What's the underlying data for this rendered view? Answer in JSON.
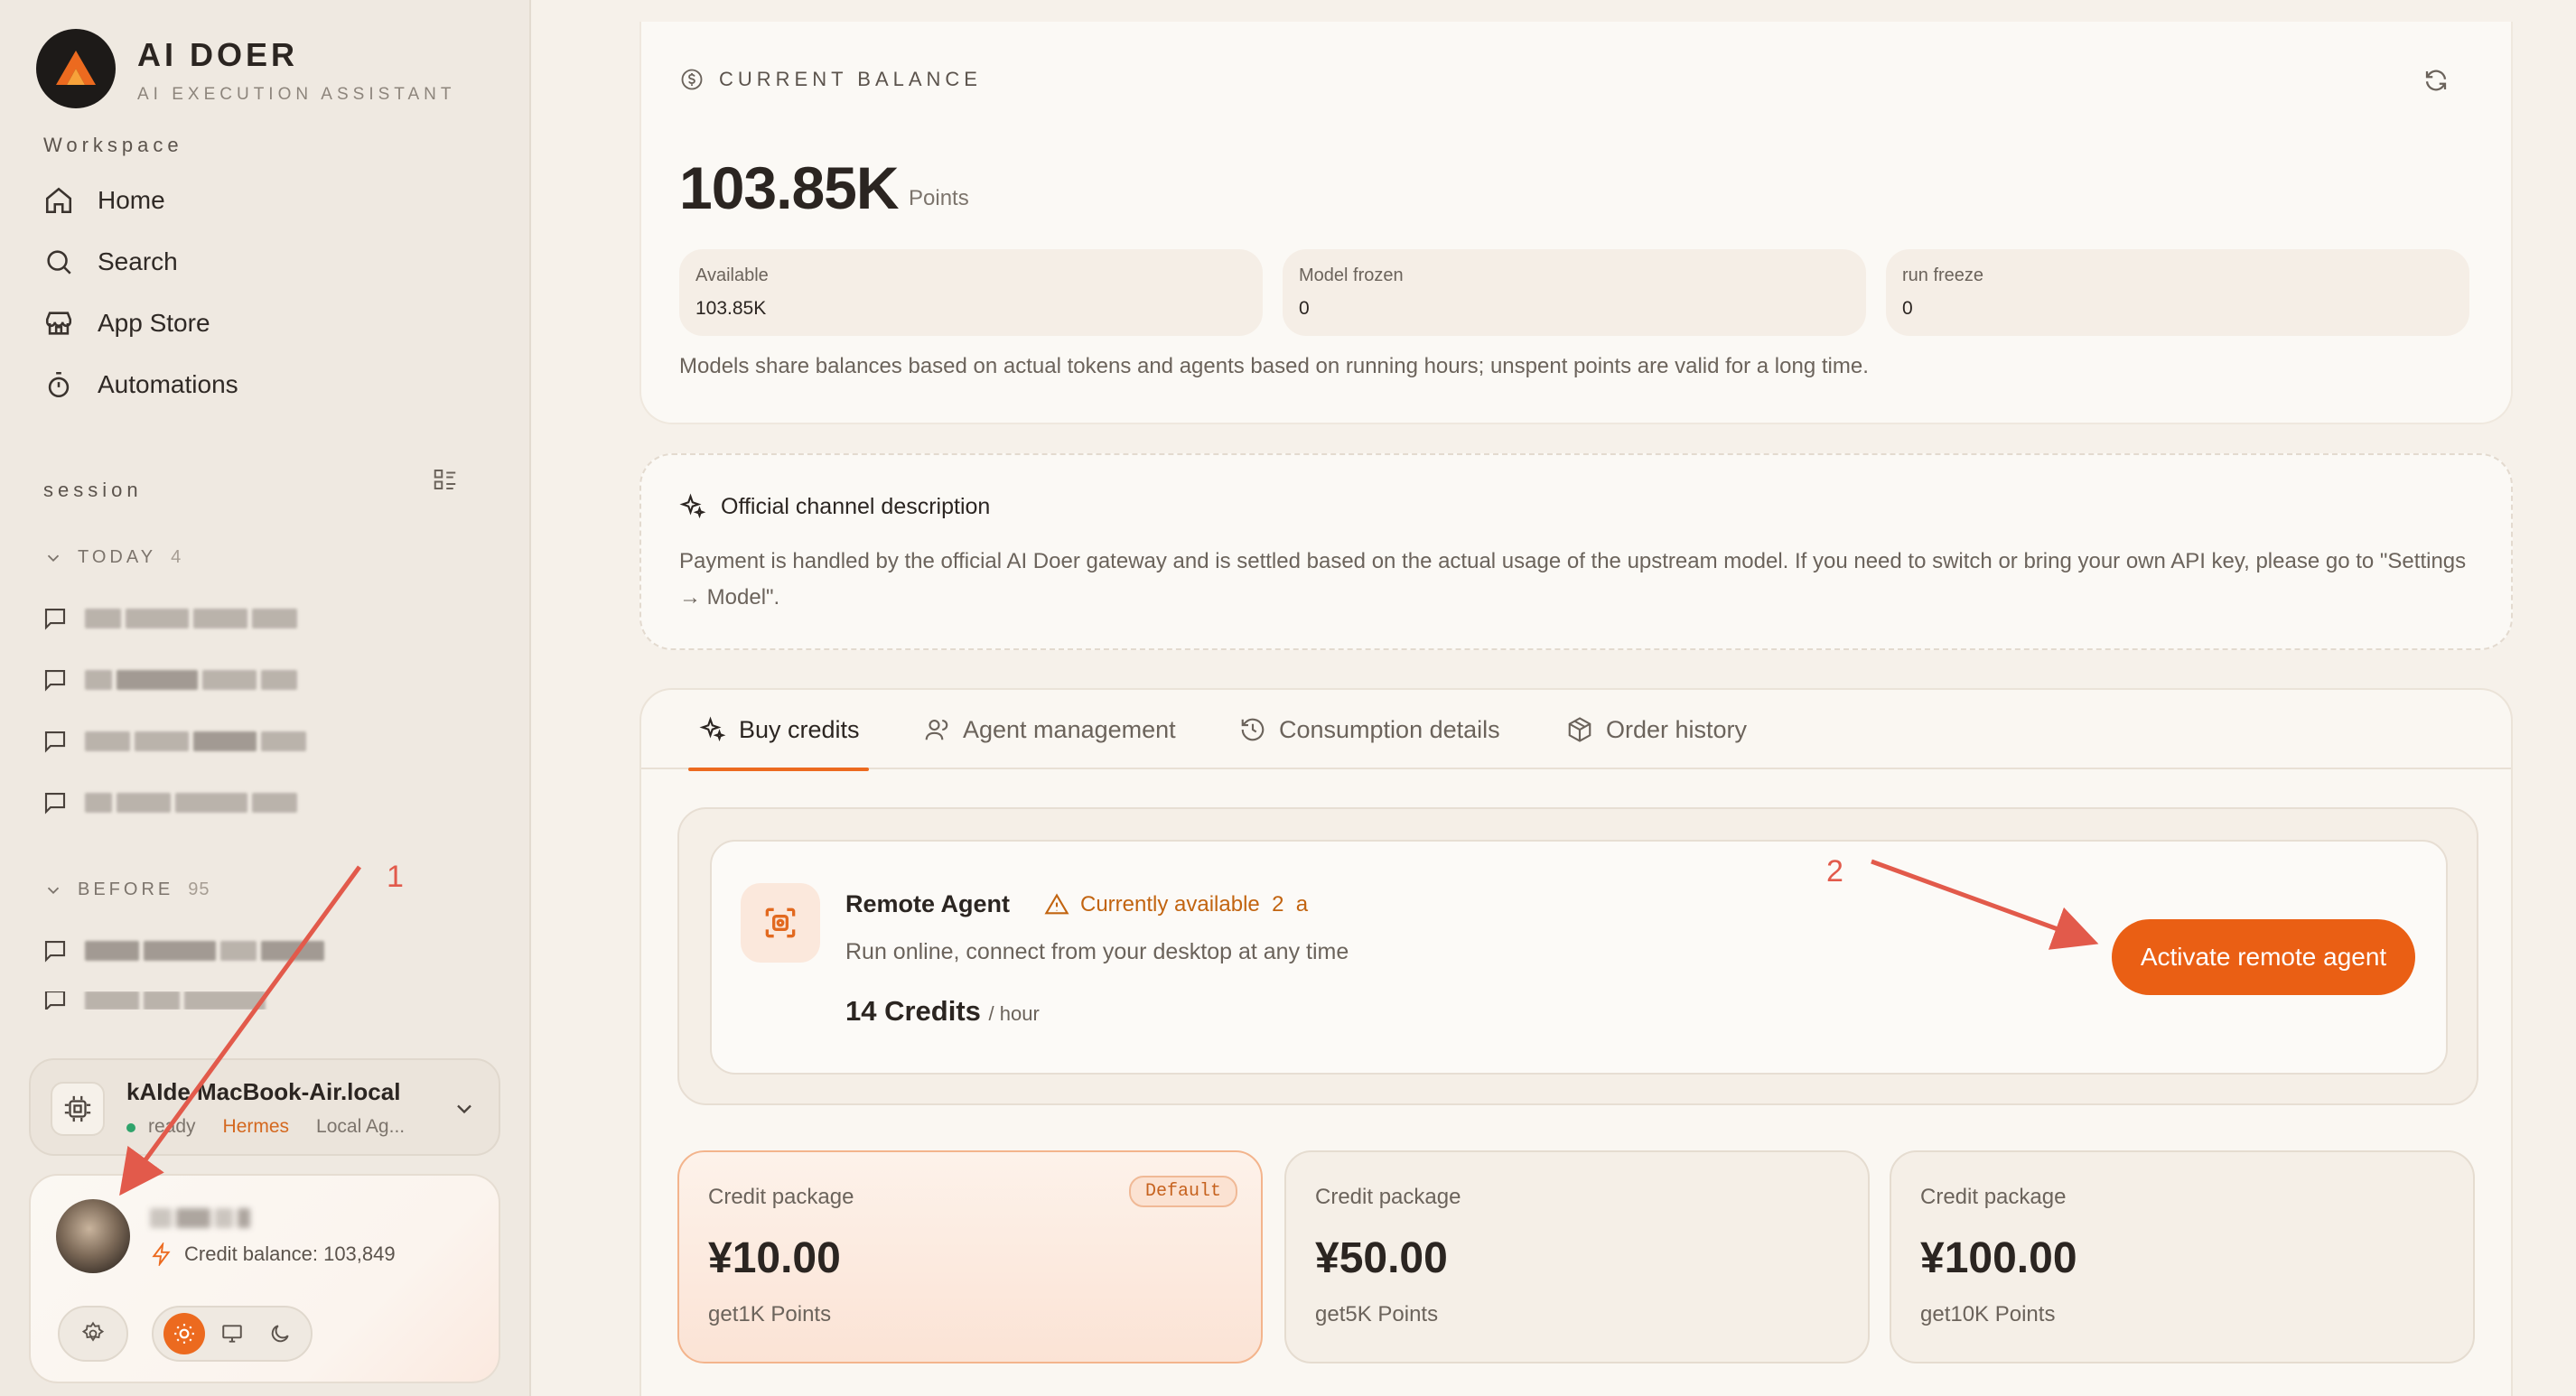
{
  "brand": {
    "name": "AI DOER",
    "subtitle": "AI EXECUTION ASSISTANT"
  },
  "nav": {
    "section_label": "Workspace",
    "items": [
      {
        "label": "Home",
        "icon": "home-icon"
      },
      {
        "label": "Search",
        "icon": "search-icon"
      },
      {
        "label": "App Store",
        "icon": "store-icon"
      },
      {
        "label": "Automations",
        "icon": "timer-icon"
      }
    ]
  },
  "sessions": {
    "section_label": "session",
    "today": {
      "label": "TODAY",
      "count": "4"
    },
    "before": {
      "label": "BEFORE",
      "count": "95"
    }
  },
  "device": {
    "name": "kAIde MacBook-Air.local",
    "status": "ready",
    "agent": "Hermes",
    "mode": "Local Ag..."
  },
  "user": {
    "credit_balance": "Credit balance: 103,849"
  },
  "balance": {
    "label": "CURRENT BALANCE",
    "value": "103.85K",
    "unit": "Points",
    "stats": [
      {
        "label": "Available",
        "value": "103.85K"
      },
      {
        "label": "Model frozen",
        "value": "0"
      },
      {
        "label": "run freeze",
        "value": "0"
      }
    ],
    "note": "Models share balances based on actual tokens and agents based on running hours; unspent points are valid for a long time."
  },
  "channel": {
    "title": "Official channel description",
    "body": "Payment is handled by the official AI Doer gateway and is settled based on the actual usage of the upstream model. If you need to switch or bring your own API key, please go to \"Settings → Model\"."
  },
  "tabs": [
    {
      "label": "Buy credits",
      "icon": "sparkle-icon"
    },
    {
      "label": "Agent management",
      "icon": "user-icon"
    },
    {
      "label": "Consumption details",
      "icon": "history-icon"
    },
    {
      "label": "Order history",
      "icon": "package-icon"
    }
  ],
  "agent": {
    "title": "Remote Agent",
    "availability": "Currently available  2  a",
    "description": "Run online, connect from your desktop at any time",
    "price": "14 Credits",
    "price_unit": "/ hour",
    "button": "Activate remote agent"
  },
  "packages": [
    {
      "label": "Credit package",
      "price": "¥10.00",
      "points": "get1K Points",
      "badge": "Default"
    },
    {
      "label": "Credit package",
      "price": "¥50.00",
      "points": "get5K Points"
    },
    {
      "label": "Credit package",
      "price": "¥100.00",
      "points": "get10K Points"
    }
  ],
  "annotations": {
    "one": "1",
    "two": "2"
  },
  "colors": {
    "accent": "#ea5f14",
    "annotation": "#e25a4b",
    "warning": "#c26410"
  }
}
